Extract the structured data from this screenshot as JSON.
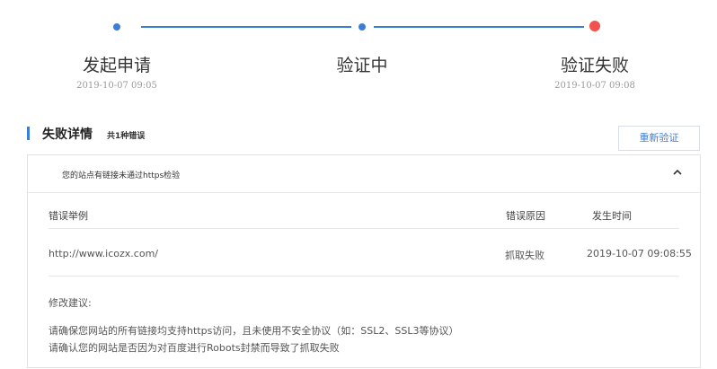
{
  "colors": {
    "accent": "#3b7ed8",
    "error": "#f1514f",
    "muted": "#999999"
  },
  "steps": [
    {
      "title": "发起申请",
      "time": "2019-10-07 09:05",
      "state": "done"
    },
    {
      "title": "验证中",
      "time": "",
      "state": "done"
    },
    {
      "title": "验证失败",
      "time": "2019-10-07 09:08",
      "state": "failed"
    }
  ],
  "section": {
    "title": "失败详情",
    "count": "共1种错误",
    "reverify_label": "重新验证"
  },
  "error_item": {
    "title": "您的站点有链接未通过https检验",
    "collapse_icon": "chevron-up-icon",
    "columns": [
      "错误举例",
      "错误原因",
      "发生时间"
    ],
    "rows": [
      [
        "http://www.icozx.com/",
        "抓取失败",
        "2019-10-07 09:08:55"
      ]
    ],
    "suggestion_title": "修改建议:",
    "suggestions": [
      "请确保您网站的所有链接均支持https访问，且未使用不安全协议（如：SSL2、SSL3等协议）",
      "请确认您的网站是否因为对百度进行Robots封禁而导致了抓取失败"
    ]
  }
}
